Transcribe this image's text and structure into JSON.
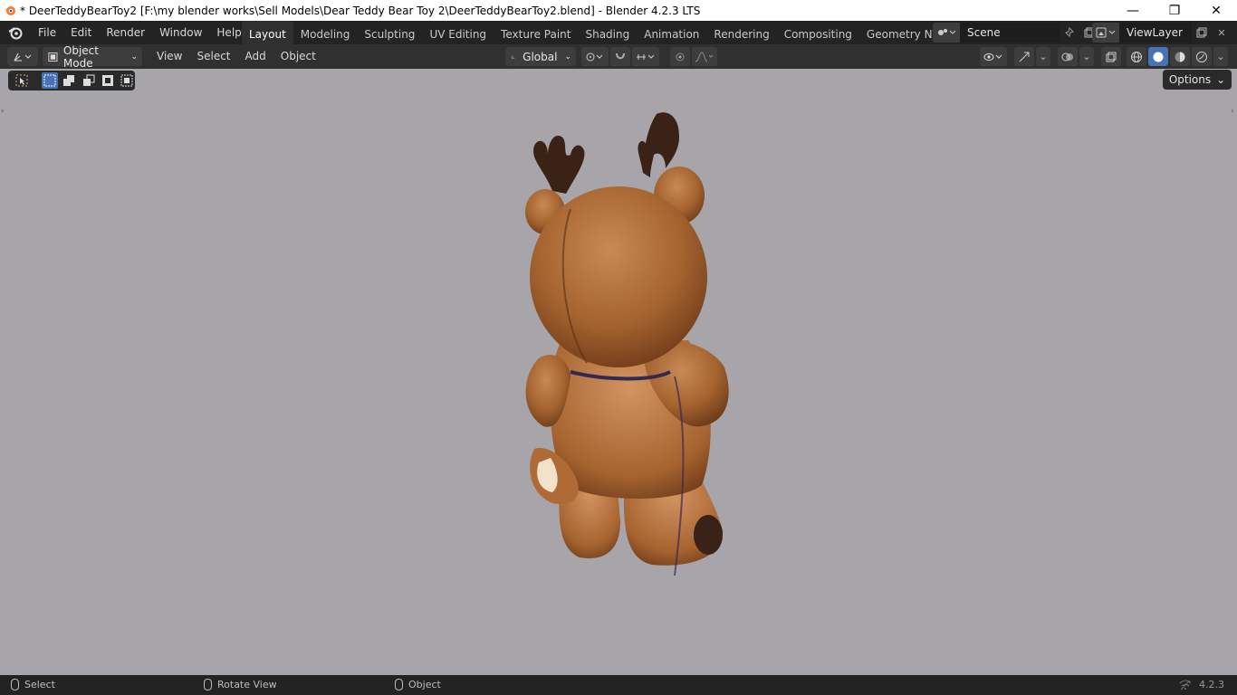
{
  "window": {
    "title": "* DeerTeddyBearToy2 [F:\\my blender works\\Sell Models\\Dear Teddy Bear Toy 2\\DeerTeddyBearToy2.blend] - Blender 4.2.3 LTS",
    "minimize": "—",
    "restore": "❐",
    "close": "✕"
  },
  "menubar": {
    "items": [
      "File",
      "Edit",
      "Render",
      "Window",
      "Help"
    ]
  },
  "workspaces": {
    "tabs": [
      "Layout",
      "Modeling",
      "Sculpting",
      "UV Editing",
      "Texture Paint",
      "Shading",
      "Animation",
      "Rendering",
      "Compositing",
      "Geometry Nodes"
    ],
    "active": "Layout"
  },
  "scene": {
    "name": "Scene"
  },
  "view_layer": {
    "name": "ViewLayer"
  },
  "header": {
    "mode": "Object Mode",
    "menus": [
      "View",
      "Select",
      "Add",
      "Object"
    ],
    "orientation": "Global"
  },
  "viewport": {
    "options_label": "Options",
    "background": "#a7a5aa",
    "object": "deer teddy bear toy (back view)"
  },
  "statusbar": {
    "select": "Select",
    "rotate": "Rotate View",
    "object": "Object",
    "version": "4.2.3"
  },
  "colors": {
    "accent": "#4772b3",
    "topbar": "#232323",
    "header": "#303030"
  }
}
